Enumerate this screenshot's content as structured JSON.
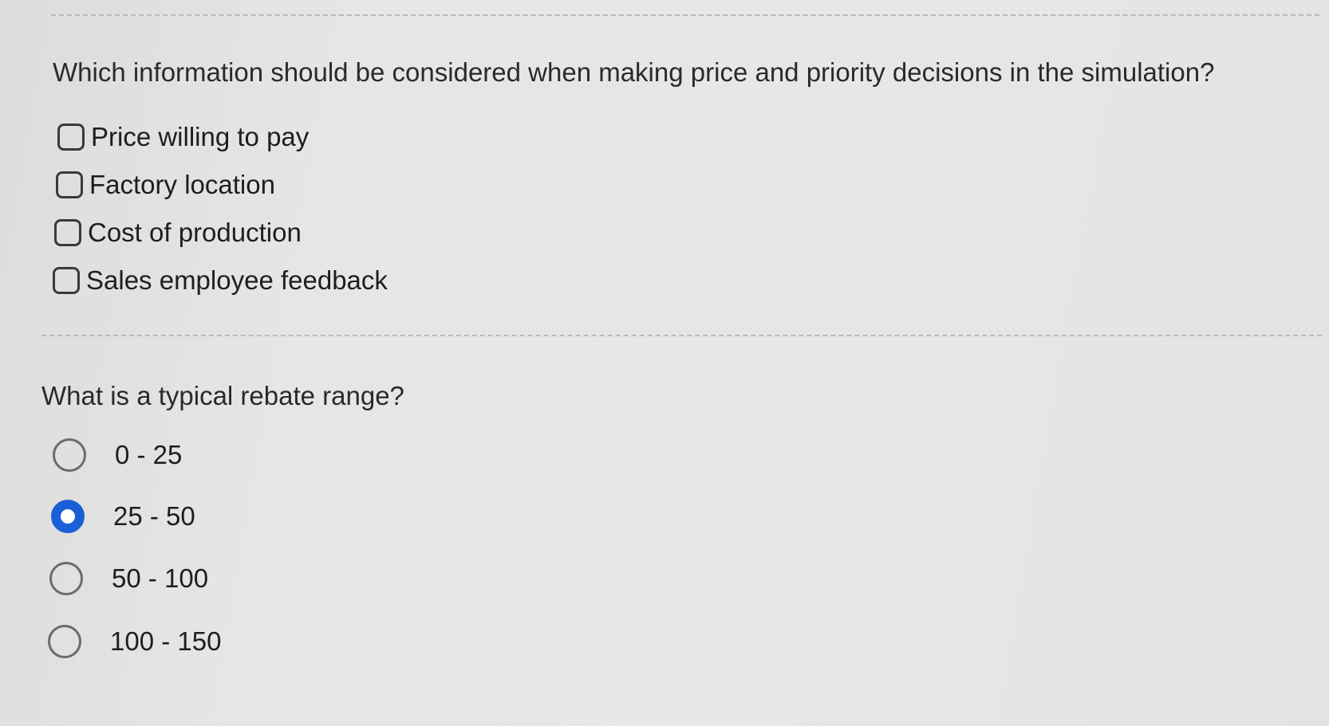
{
  "q1": {
    "text": "Which information should be considered when making price and priority decisions in the simulation?",
    "options": [
      {
        "label": "Price willing to pay",
        "checked": false
      },
      {
        "label": "Factory location",
        "checked": false
      },
      {
        "label": "Cost of production",
        "checked": false
      },
      {
        "label": "Sales employee feedback",
        "checked": false
      }
    ]
  },
  "q2": {
    "text": "What is a typical rebate range?",
    "options": [
      {
        "label": "0 - 25",
        "selected": false
      },
      {
        "label": "25 - 50",
        "selected": true
      },
      {
        "label": "50 - 100",
        "selected": false
      },
      {
        "label": "100 - 150",
        "selected": false
      }
    ]
  },
  "colors": {
    "accent": "#1a5fd6",
    "background": "#e4e4e2"
  }
}
